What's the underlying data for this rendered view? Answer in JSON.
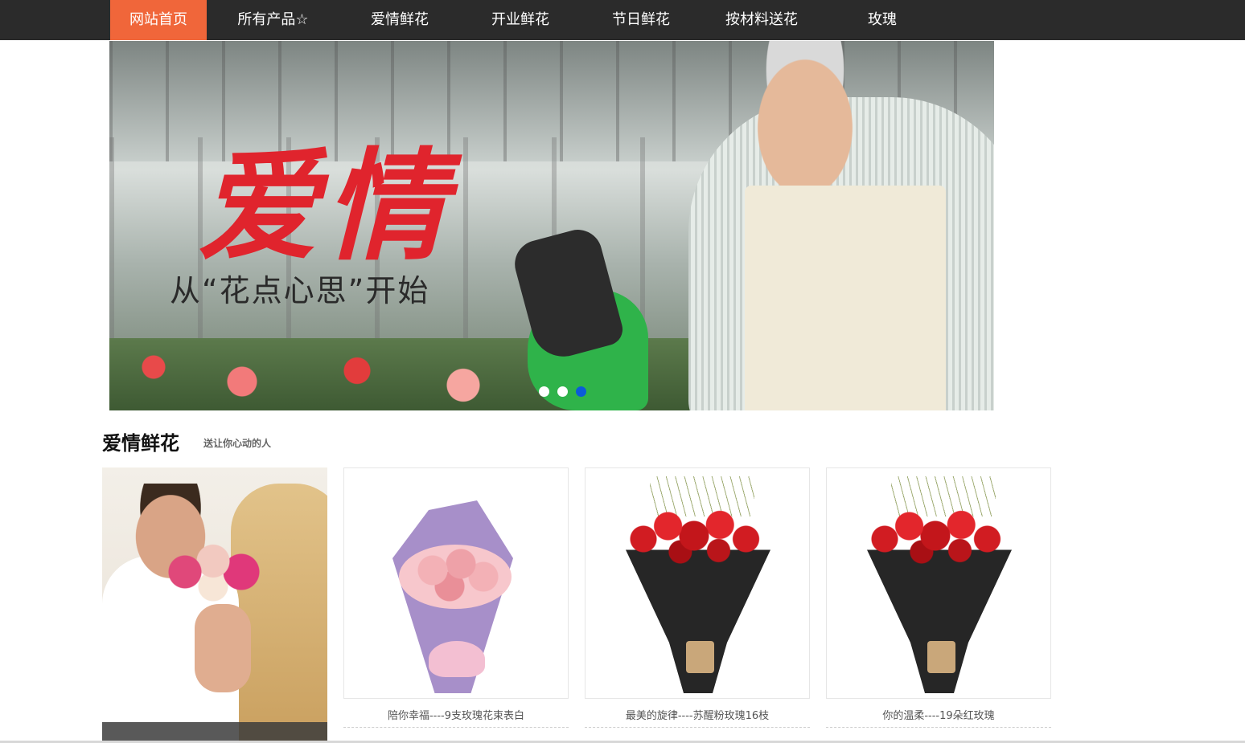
{
  "nav": {
    "items": [
      {
        "label": "网站首页",
        "active": true
      },
      {
        "label": "所有产品☆"
      },
      {
        "label": "爱情鲜花"
      },
      {
        "label": "开业鲜花"
      },
      {
        "label": "节日鲜花"
      },
      {
        "label": "按材料送花"
      },
      {
        "label": "玫瑰"
      }
    ],
    "bg_color": "#2b2b2b",
    "active_color": "#f0663a"
  },
  "banner": {
    "headline": "爱情",
    "tagline": "从“花点心思”开始",
    "slide_count": 3,
    "active_slide": 3,
    "active_dot_color": "#0b5bd8"
  },
  "section": {
    "title": "爱情鲜花",
    "subtitle": "送让你心动的人"
  },
  "products": [
    {
      "name": "陪你幸福----9支玫瑰花束表白",
      "image": "pink-carnation-bouquet-purple-wrap"
    },
    {
      "name": "最美的旋律----苏醒粉玫瑰16枝",
      "image": "red-rose-bouquet-black-wrap"
    },
    {
      "name": "你的温柔----19朵红玫瑰",
      "image": "red-rose-bouquet-black-wrap"
    }
  ],
  "colors": {
    "price": "#e4212b"
  }
}
